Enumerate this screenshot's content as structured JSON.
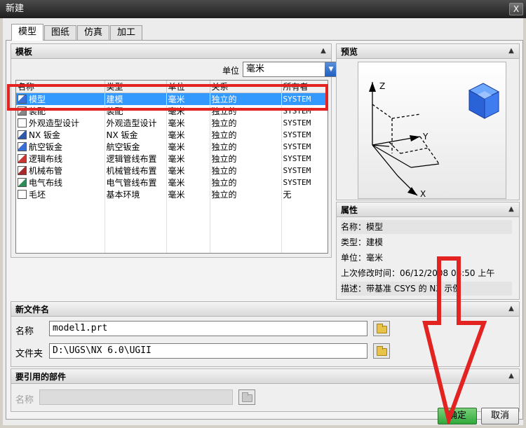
{
  "window": {
    "title": "新建",
    "close_label": "X"
  },
  "tabs": [
    "模型",
    "图纸",
    "仿真",
    "加工"
  ],
  "template_section": {
    "title": "模板",
    "unit_label": "单位",
    "unit_value": "毫米",
    "columns": [
      "名称",
      "类型",
      "单位",
      "关系",
      "所有者"
    ],
    "rows": [
      {
        "name": "模型",
        "type": "建模",
        "unit": "毫米",
        "relation": "独立的",
        "owner": "SYSTEM",
        "icon": "model-file-icon",
        "selected": true
      },
      {
        "name": "装配",
        "type": "装配",
        "unit": "毫米",
        "relation": "独立的",
        "owner": "SYSTEM",
        "icon": "assembly-file-icon"
      },
      {
        "name": "外观造型设计",
        "type": "外观造型设计",
        "unit": "毫米",
        "relation": "独立的",
        "owner": "SYSTEM",
        "icon": "shape-studio-file-icon"
      },
      {
        "name": "NX 钣金",
        "type": "NX 钣金",
        "unit": "毫米",
        "relation": "独立的",
        "owner": "SYSTEM",
        "icon": "sheet-metal-file-icon"
      },
      {
        "name": "航空钣金",
        "type": "航空钣金",
        "unit": "毫米",
        "relation": "独立的",
        "owner": "SYSTEM",
        "icon": "aero-sheet-metal-file-icon"
      },
      {
        "name": "逻辑布线",
        "type": "逻辑管线布置",
        "unit": "毫米",
        "relation": "独立的",
        "owner": "SYSTEM",
        "icon": "logical-routing-file-icon"
      },
      {
        "name": "机械布管",
        "type": "机械管线布置",
        "unit": "毫米",
        "relation": "独立的",
        "owner": "SYSTEM",
        "icon": "mechanical-routing-file-icon"
      },
      {
        "name": "电气布线",
        "type": "电气管线布置",
        "unit": "毫米",
        "relation": "独立的",
        "owner": "SYSTEM",
        "icon": "electrical-routing-file-icon"
      },
      {
        "name": "毛坯",
        "type": "基本环境",
        "unit": "毫米",
        "relation": "独立的",
        "owner": "无",
        "icon": "blank-file-icon"
      }
    ]
  },
  "preview_section": {
    "title": "预览",
    "axis_x": "X",
    "axis_y": "Y",
    "axis_z": "Z"
  },
  "properties_section": {
    "title": "属性",
    "rows": [
      "名称：模型",
      "类型：建模",
      "单位：毫米",
      "上次修改时间：06/12/2008 08:50 上午",
      "描述：带基准 CSYS 的 NX 示例"
    ]
  },
  "new_file_section": {
    "title": "新文件名",
    "name_label": "名称",
    "name_value": "model1.prt",
    "folder_label": "文件夹",
    "folder_value": "D:\\UGS\\NX 6.0\\UGII"
  },
  "referenced_section": {
    "title": "要引用的部件",
    "name_label": "名称",
    "name_value": ""
  },
  "buttons": {
    "ok": "确定",
    "cancel": "取消"
  },
  "colors": {
    "selection": "#3399ff",
    "annotation_red": "#e32222",
    "ok_green": "#2fa83a"
  }
}
